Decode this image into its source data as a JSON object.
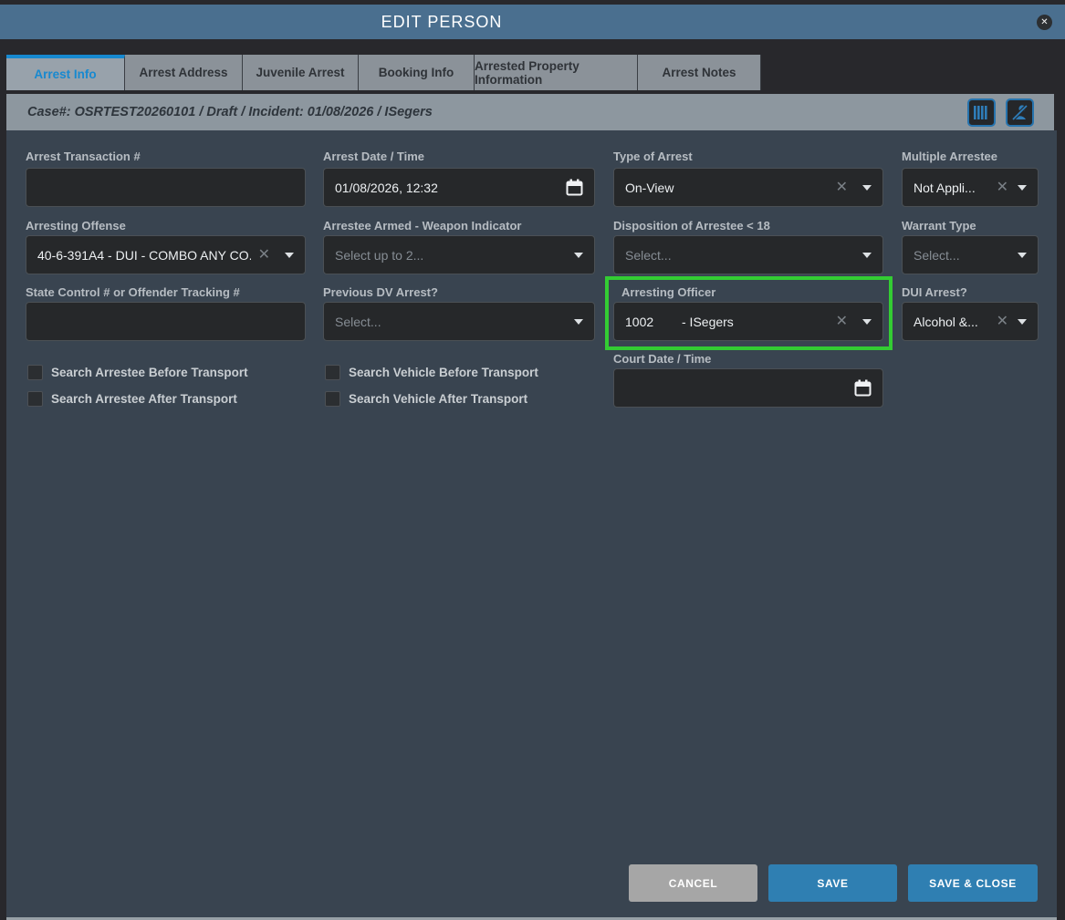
{
  "window": {
    "title": "EDIT PERSON"
  },
  "icons": {
    "close": "✕",
    "clear": "✕"
  },
  "tabs": [
    {
      "label": "Arrest Info",
      "active": true
    },
    {
      "label": "Arrest Address",
      "active": false
    },
    {
      "label": "Juvenile Arrest",
      "active": false
    },
    {
      "label": "Booking Info",
      "active": false
    },
    {
      "label": "Arrested Property Information",
      "active": false
    },
    {
      "label": "Arrest Notes",
      "active": false
    }
  ],
  "case_bar": {
    "text": "Case#: OSRTEST20260101 / Draft / Incident: 01/08/2026 / ISegers",
    "icons": [
      "barcode-icon",
      "person-slash-icon"
    ]
  },
  "form": {
    "arrest_transaction": {
      "label": "Arrest Transaction #",
      "value": ""
    },
    "arrest_datetime": {
      "label": "Arrest Date / Time",
      "value": "01/08/2026, 12:32"
    },
    "type_of_arrest": {
      "label": "Type of Arrest",
      "value": "On-View"
    },
    "multiple_arrestee": {
      "label": "Multiple Arrestee",
      "value": "Not Appli..."
    },
    "arresting_offense": {
      "label": "Arresting Offense",
      "value": "40-6-391A4 - DUI - COMBO ANY CO..."
    },
    "arrestee_armed": {
      "label": "Arrestee Armed - Weapon Indicator",
      "placeholder": "Select up to 2..."
    },
    "disposition": {
      "label": "Disposition of Arrestee < 18",
      "placeholder": "Select..."
    },
    "warrant_type": {
      "label": "Warrant Type",
      "placeholder": "Select..."
    },
    "state_control": {
      "label": "State Control # or Offender Tracking #",
      "value": ""
    },
    "previous_dv": {
      "label": "Previous DV Arrest?",
      "placeholder": "Select..."
    },
    "arresting_officer": {
      "label": "Arresting Officer",
      "code": "1002",
      "name": "- ISegers",
      "highlighted": true
    },
    "dui_arrest": {
      "label": "DUI Arrest?",
      "value": "Alcohol &..."
    },
    "court_datetime": {
      "label": "Court Date / Time",
      "value": ""
    }
  },
  "checkboxes": [
    {
      "label": "Search Arrestee Before Transport",
      "checked": false
    },
    {
      "label": "Search Arrestee After Transport",
      "checked": false
    },
    {
      "label": "Search Vehicle Before Transport",
      "checked": false
    },
    {
      "label": "Search Vehicle After Transport",
      "checked": false
    }
  ],
  "buttons": {
    "cancel": "CANCEL",
    "save": "SAVE",
    "save_close": "SAVE & CLOSE"
  },
  "colors": {
    "titlebar": "#4a6f8f",
    "accent_blue": "#2f7fb2",
    "tab_active_blue": "#1789d0",
    "highlight_green": "#33cc33",
    "panel": "#394450"
  }
}
